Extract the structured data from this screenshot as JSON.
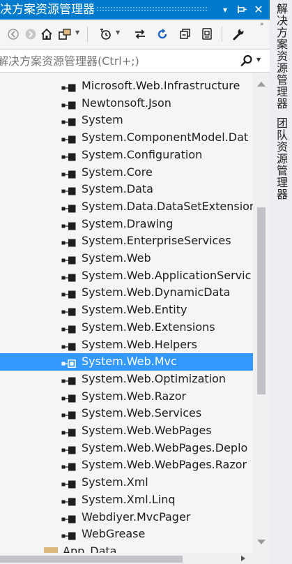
{
  "window": {
    "title": "决方案资源管理器",
    "dropdown_glyph": "▾",
    "pin_glyph": "⊣",
    "close_glyph": "✕"
  },
  "toolbar": {
    "settings_glyph": "⚙"
  },
  "search": {
    "placeholder": "索解决方案资源管理器(Ctrl+;)"
  },
  "tree": {
    "items": [
      {
        "label": "Microsoft.Web.Infrastructure",
        "selected": false
      },
      {
        "label": "Newtonsoft.Json",
        "selected": false
      },
      {
        "label": "System",
        "selected": false
      },
      {
        "label": "System.ComponentModel.Dat",
        "selected": false
      },
      {
        "label": "System.Configuration",
        "selected": false
      },
      {
        "label": "System.Core",
        "selected": false
      },
      {
        "label": "System.Data",
        "selected": false
      },
      {
        "label": "System.Data.DataSetExtension",
        "selected": false
      },
      {
        "label": "System.Drawing",
        "selected": false
      },
      {
        "label": "System.EnterpriseServices",
        "selected": false
      },
      {
        "label": "System.Web",
        "selected": false
      },
      {
        "label": "System.Web.ApplicationServic",
        "selected": false
      },
      {
        "label": "System.Web.DynamicData",
        "selected": false
      },
      {
        "label": "System.Web.Entity",
        "selected": false
      },
      {
        "label": "System.Web.Extensions",
        "selected": false
      },
      {
        "label": "System.Web.Helpers",
        "selected": false
      },
      {
        "label": "System.Web.Mvc",
        "selected": true
      },
      {
        "label": "System.Web.Optimization",
        "selected": false
      },
      {
        "label": "System.Web.Razor",
        "selected": false
      },
      {
        "label": "System.Web.Services",
        "selected": false
      },
      {
        "label": "System.Web.WebPages",
        "selected": false
      },
      {
        "label": "System.Web.WebPages.Deplo",
        "selected": false
      },
      {
        "label": "System.Web.WebPages.Razor",
        "selected": false
      },
      {
        "label": "System.Xml",
        "selected": false
      },
      {
        "label": "System.Xml.Linq",
        "selected": false
      },
      {
        "label": "Webdiyer.MvcPager",
        "selected": false
      },
      {
        "label": "WebGrease",
        "selected": false
      }
    ],
    "folder": {
      "label": "App_Data"
    }
  },
  "side_tabs": {
    "solution_explorer": "解决方案资源管理器",
    "team_explorer": "团队资源管理器"
  },
  "colors": {
    "accent": "#007acc",
    "selection": "#3399ff",
    "background": "#f5f5f5"
  }
}
